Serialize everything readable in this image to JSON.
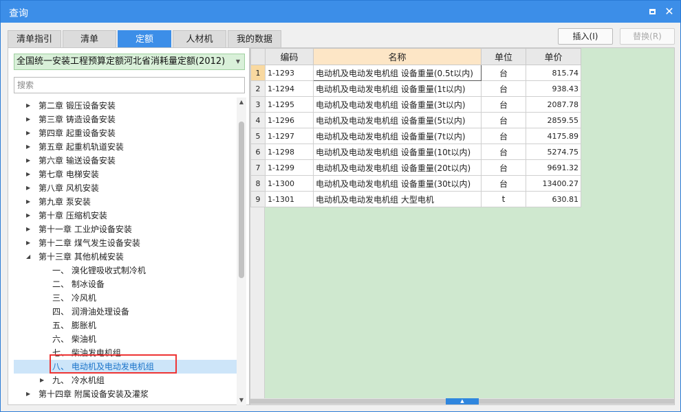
{
  "window": {
    "title": "查询"
  },
  "tabs": [
    {
      "label": "清单指引",
      "active": false
    },
    {
      "label": "清单",
      "active": false
    },
    {
      "label": "定额",
      "active": true
    },
    {
      "label": "人材机",
      "active": false
    },
    {
      "label": "我的数据",
      "active": false
    }
  ],
  "actions": {
    "insert_label": "插入(I)",
    "replace_label": "替换(R)"
  },
  "library": {
    "selected": "全国统一安装工程预算定额河北省消耗量定额(2012)"
  },
  "search": {
    "placeholder": "搜索",
    "value": ""
  },
  "tree": {
    "items": [
      {
        "label": "第二章 锻压设备安装",
        "expanded": false,
        "level": 1
      },
      {
        "label": "第三章 铸造设备安装",
        "expanded": false,
        "level": 1
      },
      {
        "label": "第四章 起重设备安装",
        "expanded": false,
        "level": 1
      },
      {
        "label": "第五章 起重机轨道安装",
        "expanded": false,
        "level": 1
      },
      {
        "label": "第六章 输送设备安装",
        "expanded": false,
        "level": 1
      },
      {
        "label": "第七章 电梯安装",
        "expanded": false,
        "level": 1
      },
      {
        "label": "第八章 风机安装",
        "expanded": false,
        "level": 1
      },
      {
        "label": "第九章 泵安装",
        "expanded": false,
        "level": 1
      },
      {
        "label": "第十章 压缩机安装",
        "expanded": false,
        "level": 1
      },
      {
        "label": "第十一章 工业炉设备安装",
        "expanded": false,
        "level": 1
      },
      {
        "label": "第十二章 煤气发生设备安装",
        "expanded": false,
        "level": 1
      },
      {
        "label": "第十三章 其他机械安装",
        "expanded": true,
        "level": 1
      },
      {
        "label": "一、 溴化锂吸收式制冷机",
        "level": 2
      },
      {
        "label": "二、 制冰设备",
        "level": 2
      },
      {
        "label": "三、 冷风机",
        "level": 2
      },
      {
        "label": "四、 润滑油处理设备",
        "level": 2
      },
      {
        "label": "五、 膨胀机",
        "level": 2
      },
      {
        "label": "六、 柴油机",
        "level": 2
      },
      {
        "label": "七、 柴油发电机组",
        "level": 2
      },
      {
        "label": "八、 电动机及电动发电机组",
        "level": 2,
        "selected": true
      },
      {
        "label": "九、 冷水机组",
        "level": 2,
        "expanded": false
      },
      {
        "label": "第十四章 附属设备安装及灌浆",
        "expanded": false,
        "level": 1
      }
    ]
  },
  "grid": {
    "columns": {
      "code": "编码",
      "name": "名称",
      "unit": "单位",
      "price": "单价"
    },
    "rows": [
      {
        "num": "1",
        "code": "1-1293",
        "name": "电动机及电动发电机组 设备重量(0.5t以内)",
        "unit": "台",
        "price": "815.74"
      },
      {
        "num": "2",
        "code": "1-1294",
        "name": "电动机及电动发电机组 设备重量(1t以内)",
        "unit": "台",
        "price": "938.43"
      },
      {
        "num": "3",
        "code": "1-1295",
        "name": "电动机及电动发电机组 设备重量(3t以内)",
        "unit": "台",
        "price": "2087.78"
      },
      {
        "num": "4",
        "code": "1-1296",
        "name": "电动机及电动发电机组 设备重量(5t以内)",
        "unit": "台",
        "price": "2859.55"
      },
      {
        "num": "5",
        "code": "1-1297",
        "name": "电动机及电动发电机组 设备重量(7t以内)",
        "unit": "台",
        "price": "4175.89"
      },
      {
        "num": "6",
        "code": "1-1298",
        "name": "电动机及电动发电机组 设备重量(10t以内)",
        "unit": "台",
        "price": "5274.75"
      },
      {
        "num": "7",
        "code": "1-1299",
        "name": "电动机及电动发电机组 设备重量(20t以内)",
        "unit": "台",
        "price": "9691.32"
      },
      {
        "num": "8",
        "code": "1-1300",
        "name": "电动机及电动发电机组 设备重量(30t以内)",
        "unit": "台",
        "price": "13400.27"
      },
      {
        "num": "9",
        "code": "1-1301",
        "name": "电动机及电动发电机组 大型电机",
        "unit": "t",
        "price": "630.81"
      }
    ]
  },
  "colors": {
    "accent": "#3c8ee8",
    "highlight": "#ee3333",
    "grid_bg": "#cfe8cf"
  }
}
